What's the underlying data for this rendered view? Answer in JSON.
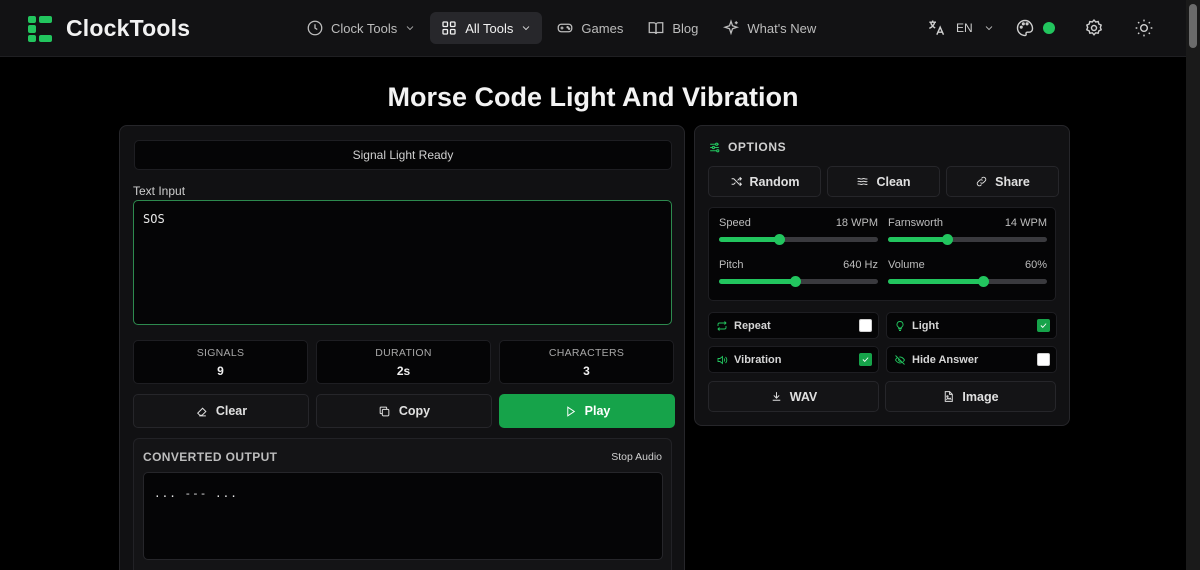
{
  "app": {
    "name": "ClockTools"
  },
  "nav": {
    "items": [
      {
        "label": "Clock Tools",
        "icon": "clock-icon",
        "dropdown": true,
        "active": false
      },
      {
        "label": "All Tools",
        "icon": "grid-icon",
        "dropdown": true,
        "active": true
      },
      {
        "label": "Games",
        "icon": "gamepad-icon",
        "dropdown": false,
        "active": false
      },
      {
        "label": "Blog",
        "icon": "book-icon",
        "dropdown": false,
        "active": false
      },
      {
        "label": "What's New",
        "icon": "sparkle-icon",
        "dropdown": false,
        "active": false
      }
    ],
    "language": "EN"
  },
  "colors": {
    "accent": "#22c55e",
    "accent_button": "#16a34a",
    "background": "#000000",
    "panel": "#111113"
  },
  "page": {
    "title": "Morse Code Light And Vibration"
  },
  "converter": {
    "status": "Signal Light Ready",
    "input_label": "Text Input",
    "input_value": "SOS",
    "stats": [
      {
        "label": "SIGNALS",
        "value": "9"
      },
      {
        "label": "DURATION",
        "value": "2s"
      },
      {
        "label": "CHARACTERS",
        "value": "3"
      }
    ],
    "buttons": {
      "clear": "Clear",
      "copy": "Copy",
      "play": "Play"
    },
    "output": {
      "title": "CONVERTED OUTPUT",
      "stop_audio": "Stop Audio",
      "value": "... --- ..."
    }
  },
  "options": {
    "title": "OPTIONS",
    "buttons": {
      "random": "Random",
      "clean": "Clean",
      "share": "Share"
    },
    "sliders": [
      {
        "label": "Speed",
        "value": "18 WPM",
        "fraction": 0.38
      },
      {
        "label": "Farnsworth",
        "value": "14 WPM",
        "fraction": 0.37
      },
      {
        "label": "Pitch",
        "value": "640 Hz",
        "fraction": 0.48
      },
      {
        "label": "Volume",
        "value": "60%",
        "fraction": 0.6
      }
    ],
    "toggles": [
      {
        "label": "Repeat",
        "icon": "repeat-icon",
        "checked": false
      },
      {
        "label": "Light",
        "icon": "lightbulb-icon",
        "checked": true
      },
      {
        "label": "Vibration",
        "icon": "vibration-icon",
        "checked": true
      },
      {
        "label": "Hide Answer",
        "icon": "eye-off-icon",
        "checked": false
      }
    ],
    "exports": {
      "wav": "WAV",
      "image": "Image"
    }
  }
}
